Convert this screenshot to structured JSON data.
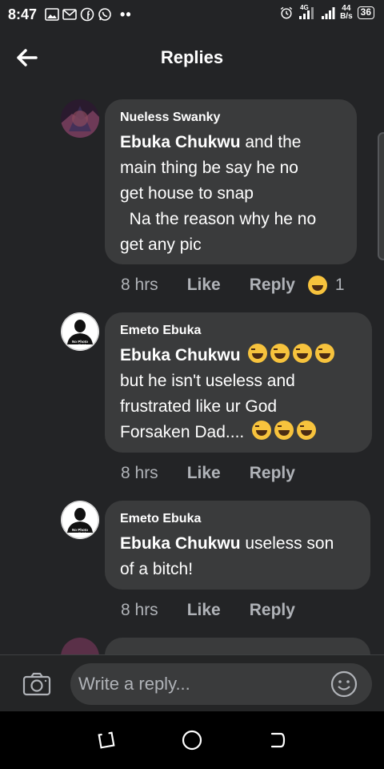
{
  "status_bar": {
    "time": "8:47",
    "network": "4G",
    "net_speed_value": "44",
    "net_speed_unit": "B/s",
    "battery": "36",
    "more_dots": "••"
  },
  "header": {
    "title": "Replies",
    "back_icon": "arrow-left-icon"
  },
  "comments": [
    {
      "author": "Nueless Swanky",
      "mention": "Ebuka Chukwu",
      "text_lines": [
        " and the",
        "main thing  be say he no",
        "get  house to snap",
        "  Na the reason why he no",
        "get any pic"
      ],
      "time": "8 hrs",
      "like_label": "Like",
      "reply_label": "Reply",
      "reaction_count": "1",
      "avatar_icon": "profile-photo-icon"
    },
    {
      "author": "Emeto Ebuka",
      "mention": "Ebuka Chukwu",
      "text_lines": [
        "but he isn't useless and",
        "frustrated like ur God",
        "Forsaken Dad...."
      ],
      "time": "8 hrs",
      "like_label": "Like",
      "reply_label": "Reply",
      "avatar_icon": "no-photo-available-icon",
      "avatar_text": "No Photo Available"
    },
    {
      "author": "Emeto Ebuka",
      "mention": "Ebuka Chukwu",
      "text_lines": [
        " useless son",
        "of a bitch!"
      ],
      "time": "8 hrs",
      "like_label": "Like",
      "reply_label": "Reply",
      "avatar_icon": "no-photo-available-icon",
      "avatar_text": "No Photo Available"
    }
  ],
  "composer": {
    "placeholder": "Write a reply...",
    "camera_icon": "camera-icon",
    "emoji_icon": "smiley-icon"
  },
  "nav_bar": {
    "icons": [
      "recents-icon",
      "home-icon",
      "back-icon"
    ]
  },
  "colors": {
    "background": "#232426",
    "bubble": "#3a3b3c",
    "muted_text": "#b0b3b8",
    "emoji": "#f7c33d"
  }
}
